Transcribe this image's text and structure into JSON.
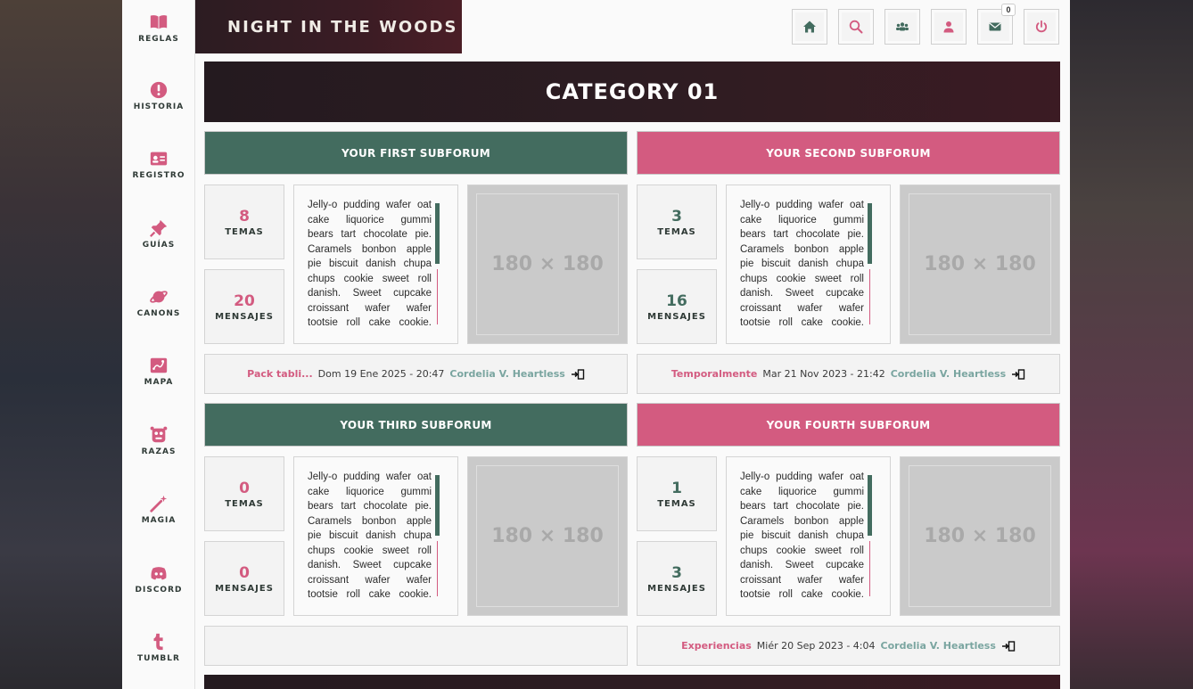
{
  "header": {
    "site_title": "NIGHT IN THE WOODS",
    "message_count": "0"
  },
  "sidebar": {
    "items": [
      {
        "label": "REGLAS",
        "icon": "book-icon"
      },
      {
        "label": "HISTORIA",
        "icon": "exclamation-icon"
      },
      {
        "label": "REGISTRO",
        "icon": "id-card-icon"
      },
      {
        "label": "GUÍAS",
        "icon": "pushpin-icon"
      },
      {
        "label": "CANONS",
        "icon": "planet-icon"
      },
      {
        "label": "MAPA",
        "icon": "map-icon"
      },
      {
        "label": "RAZAS",
        "icon": "monster-icon"
      },
      {
        "label": "MAGIA",
        "icon": "magic-wand-icon"
      },
      {
        "label": "DISCORD",
        "icon": "discord-icon"
      },
      {
        "label": "TUMBLR",
        "icon": "tumblr-icon"
      }
    ]
  },
  "category": {
    "title": "CATEGORY 01"
  },
  "forums": [
    {
      "title": "YOUR FIRST SUBFORUM",
      "topics": "8",
      "topics_label": "TEMAS",
      "posts": "20",
      "posts_label": "MENSAJES",
      "description": "Jelly-o pudding wafer oat cake liquorice gummi bears tart chocolate pie. Caramels bonbon apple pie biscuit danish chupa chups cookie sweet roll danish. Sweet cupcake croissant wafer wafer tootsie roll cake cookie. Jelly-o pudding",
      "image_label": "180 × 180",
      "last_topic": "Pack tabli...",
      "last_date": "Dom 19 Ene 2025 - 20:47",
      "last_user": "Cordelia V. Heartless"
    },
    {
      "title": "YOUR SECOND SUBFORUM",
      "topics": "3",
      "topics_label": "TEMAS",
      "posts": "16",
      "posts_label": "MENSAJES",
      "description": "Jelly-o pudding wafer oat cake liquorice gummi bears tart chocolate pie. Caramels bonbon apple pie biscuit danish chupa chups cookie sweet roll danish. Sweet cupcake croissant wafer wafer tootsie roll cake cookie. Jelly-o pudding",
      "image_label": "180 × 180",
      "last_topic": "Temporalmente",
      "last_date": "Mar 21 Nov 2023 - 21:42",
      "last_user": "Cordelia V. Heartless"
    },
    {
      "title": "YOUR THIRD SUBFORUM",
      "topics": "0",
      "topics_label": "TEMAS",
      "posts": "0",
      "posts_label": "MENSAJES",
      "description": "Jelly-o pudding wafer oat cake liquorice gummi bears tart chocolate pie. Caramels bonbon apple pie biscuit danish chupa chups cookie sweet roll danish. Sweet cupcake croissant wafer wafer tootsie roll cake cookie. Jelly-o pudding",
      "image_label": "180 × 180"
    },
    {
      "title": "YOUR FOURTH SUBFORUM",
      "topics": "1",
      "topics_label": "TEMAS",
      "posts": "3",
      "posts_label": "MENSAJES",
      "description": "Jelly-o pudding wafer oat cake liquorice gummi bears tart chocolate pie. Caramels bonbon apple pie biscuit danish chupa chups cookie sweet roll danish. Sweet cupcake croissant wafer wafer tootsie roll cake cookie. Jelly-o pudding",
      "image_label": "180 × 180",
      "last_topic": "Experiencias",
      "last_date": "Miér 20 Sep 2023 - 4:04",
      "last_user": "Cordelia V. Heartless"
    }
  ],
  "colors": {
    "accent_green": "#436c5f",
    "accent_pink": "#d35b80",
    "dark_banner": "#2d1c22"
  }
}
